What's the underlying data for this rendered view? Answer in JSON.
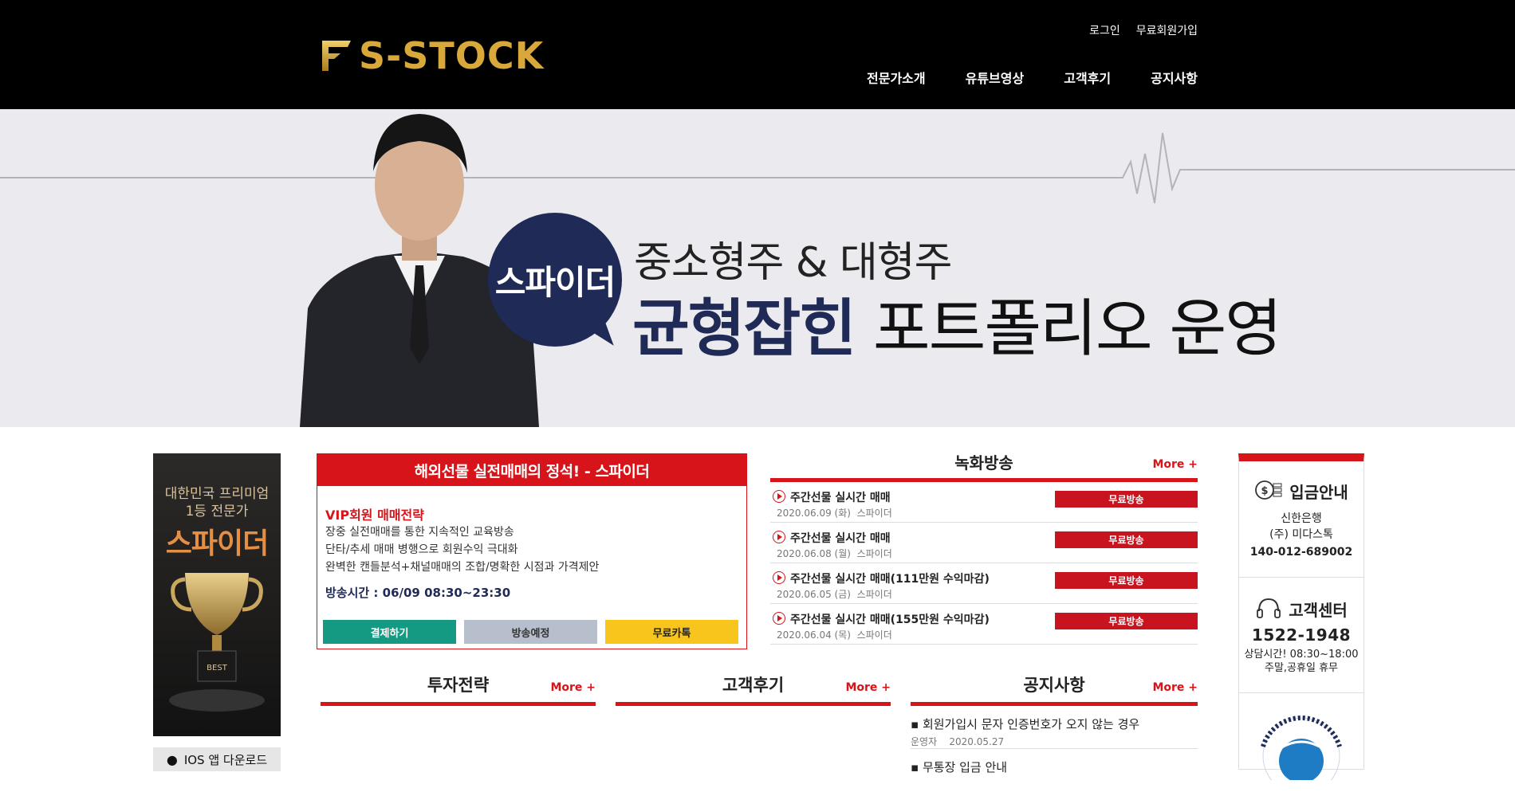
{
  "brand": {
    "name": "S-STOCK",
    "logo_color": "#d8a93a"
  },
  "util": {
    "login": "로그인",
    "signup": "무료회원가입"
  },
  "nav": {
    "items": [
      "전문가소개",
      "유튜브영상",
      "고객후기",
      "공지사항"
    ]
  },
  "hero": {
    "badge": "스파이더",
    "line1": "중소형주 & 대형주",
    "line2_em": "균형잡힌",
    "line2_rest": "포트폴리오 운영"
  },
  "left_banner": {
    "sub1": "대한민국 프리미엄",
    "sub2": "1등 전문가",
    "name": "스파이더",
    "trophy_label": "BEST",
    "ios": "IOS 앱 다운로드"
  },
  "vip": {
    "header": "해외선물 실전매매의 정석! - 스파이더",
    "title": "VIP회원 매매전략",
    "lines": [
      "장중 실전매매를 통한 지속적인 교육방송",
      "단타/추세 매매 병행으로 회원수익 극대화",
      "완벽한 캔들분석+채널매매의 조합/명확한 시점과 가격제안"
    ],
    "time": "방송시간 : 06/09 08:30~23:30",
    "buttons": {
      "pay": "결제하기",
      "schedule": "방송예정",
      "kakao": "무료카톡"
    }
  },
  "recorded": {
    "title": "녹화방송",
    "more": "More +",
    "items": [
      {
        "name": "주간선물 실시간 매매",
        "date": "2020.06.09 (화)",
        "author": "스파이더",
        "badge": "무료방송"
      },
      {
        "name": "주간선물 실시간 매매",
        "date": "2020.06.08 (월)",
        "author": "스파이더",
        "badge": "무료방송"
      },
      {
        "name": "주간선물 실시간 매매(111만원 수익마감)",
        "date": "2020.06.05 (금)",
        "author": "스파이더",
        "badge": "무료방송"
      },
      {
        "name": "주간선물 실시간 매매(155만원 수익마감)",
        "date": "2020.06.04 (목)",
        "author": "스파이더",
        "badge": "무료방송"
      }
    ]
  },
  "boards": {
    "strategy": {
      "title": "투자전략",
      "more": "More +"
    },
    "reviews": {
      "title": "고객후기",
      "more": "More +"
    },
    "notice": {
      "title": "공지사항",
      "more": "More +",
      "items": [
        {
          "title": "회원가입시 문자 인증번호가 오지 않는 경우",
          "author": "운영자",
          "date": "2020.05.27"
        },
        {
          "title": "무통장 입금 안내"
        }
      ]
    }
  },
  "side": {
    "deposit": {
      "title": "입금안내",
      "bank": "신한은행",
      "holder": "(주) 미다스톡",
      "account": "140-012-689002"
    },
    "center": {
      "title": "고객센터",
      "phone": "1522-1948",
      "hours": "상담시간! 08:30~18:00",
      "holiday": "주말,공휴일 휴무"
    }
  },
  "colors": {
    "accent": "#d7141a",
    "navy": "#1f2a57",
    "teal": "#149a82",
    "yellow": "#f7c51b"
  }
}
